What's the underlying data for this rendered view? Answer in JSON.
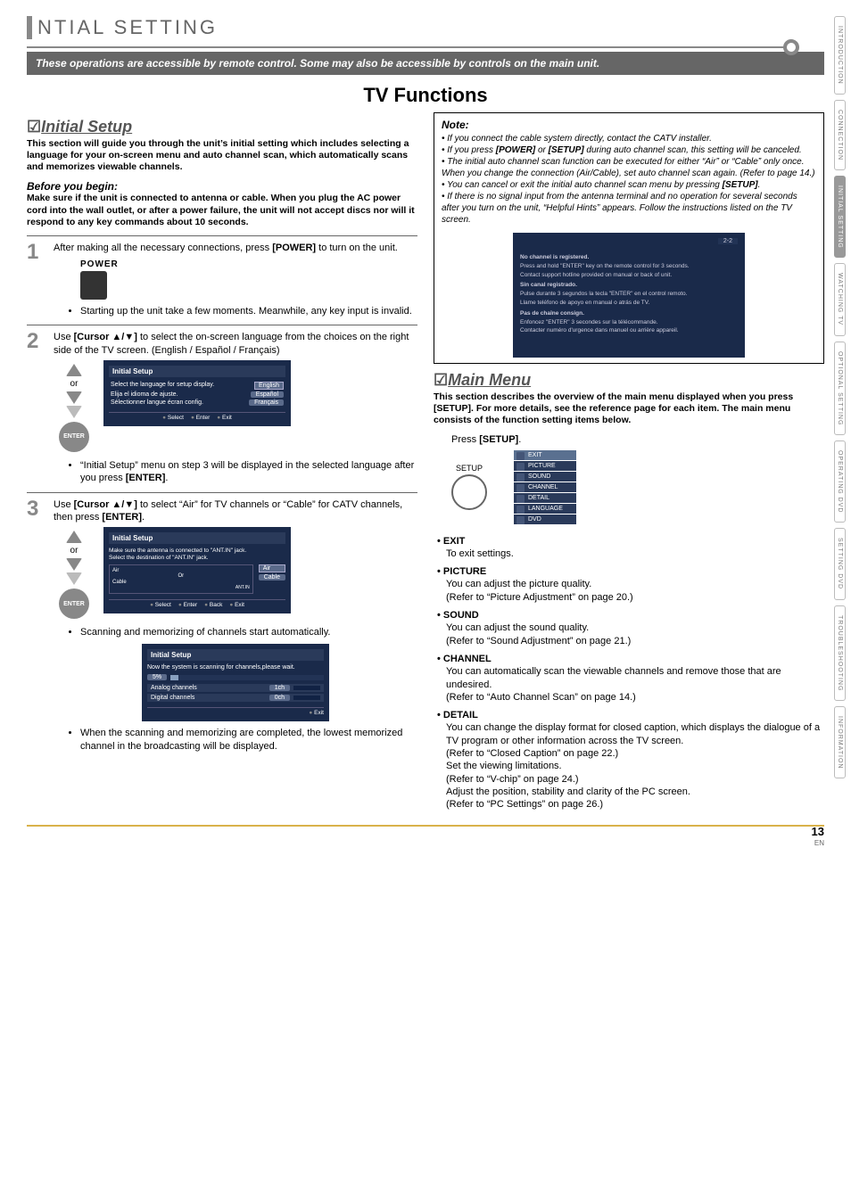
{
  "tabs": [
    "INTRODUCTION",
    "CONNECTION",
    "INITIAL SETTING",
    "WATCHING TV",
    "OPTIONAL SETTING",
    "OPERATING DVD",
    "SETTING DVD",
    "TROUBLESHOOTING",
    "INFORMATION"
  ],
  "active_tab_index": 2,
  "header_title": "NTIAL SETTING",
  "note_bar": "These operations are accessible by remote control. Some may also be accessible by controls on the main unit.",
  "section_title": "TV Functions",
  "left": {
    "heading": "Initial Setup",
    "intro": "This section will guide you through the unit’s initial setting which includes selecting a language for your on-screen menu and auto channel scan, which automatically scans and memorizes viewable channels.",
    "before_label": "Before you begin:",
    "before_text": "Make sure if the unit is connected to antenna or cable. When you plug the AC power cord into the wall outlet, or after a power failure, the unit will not accept discs nor will it respond to any key commands about 10 seconds.",
    "steps": {
      "s1": {
        "num": "1",
        "text_a": "After making all the necessary connections, press ",
        "text_b": "[POWER]",
        "text_c": " to turn on the unit.",
        "power_label": "POWER",
        "sub1": "Starting up the unit take a few moments. Meanwhile, any key input is invalid."
      },
      "s2": {
        "num": "2",
        "text_a": "Use ",
        "text_b": "[Cursor ▲/▼]",
        "text_c": " to select the on-screen language from the choices on the right side of the TV screen. (English / Español / Français)",
        "or": "or",
        "enter": "ENTER",
        "osd_title": "Initial Setup",
        "osd_r1_l": "Select the language for setup display.",
        "osd_r1_r": "English",
        "osd_r2_l": "Elija el idioma de ajuste.",
        "osd_r2_r": "Español",
        "osd_r3_l": "Sélectionner langue écran config.",
        "osd_r3_r": "Français",
        "osd_btns": [
          "Select",
          "Enter",
          "Exit"
        ],
        "sub1_a": "“Initial Setup” menu on step 3 will be displayed in the selected language after you press ",
        "sub1_b": "[ENTER]",
        "sub1_c": "."
      },
      "s3": {
        "num": "3",
        "text_a": "Use ",
        "text_b": "[Cursor ▲/▼]",
        "text_c": " to select “Air” for TV channels or “Cable” for CATV channels, then press ",
        "text_d": "[ENTER]",
        "text_e": ".",
        "or": "or",
        "enter": "ENTER",
        "osd_title": "Initial Setup",
        "osd_line1": "Make sure the antenna is connected to \"ANT.IN\" jack.",
        "osd_line2": "Select the destination of \"ANT.IN\" jack.",
        "osd_air": "Air",
        "osd_cable": "Cable",
        "osd_diag_air": "Air",
        "osd_diag_or": "Or",
        "osd_diag_cable": "Cable",
        "osd_diag_ant": "ANT.IN",
        "osd_btns": [
          "Select",
          "Enter",
          "Back",
          "Exit"
        ],
        "sub1": "Scanning and memorizing of channels start automatically.",
        "scan_title": "Initial Setup",
        "scan_msg": "Now the system is scanning for channels,please wait.",
        "scan_pct": "5%",
        "scan_analog_l": "Analog channels",
        "scan_analog_v": "1ch",
        "scan_digital_l": "Digital channels",
        "scan_digital_v": "0ch",
        "scan_exit": "Exit",
        "sub2": "When the scanning and memorizing are completed, the lowest memorized channel in the broadcasting will be displayed."
      }
    }
  },
  "right": {
    "note_title": "Note:",
    "notes": [
      "If you connect the cable system directly, contact the CATV installer.",
      "If you press <b>[POWER]</b> or <b>[SETUP]</b> during auto channel scan, this setting will be canceled.",
      "The initial auto channel scan function can be executed for either “Air” or “Cable” only once. When you change the connection (Air/Cable), set auto channel scan again. (Refer to page 14.)",
      "You can cancel or exit the initial auto channel scan menu by pressing <b>[SETUP]</b>.",
      "If there is no signal input from the antenna terminal and no operation for several seconds after you turn on the unit, “Helpful Hints” appears. Follow the instructions listed on the TV screen."
    ],
    "hh_corner": "2-2",
    "hh": {
      "en_h": "No channel is registered.",
      "en_1": "Press and hold \"ENTER\" key on the remote control for 3 seconds.",
      "en_2": "Contact support hotline provided on manual or back of unit.",
      "es_h": "Sin canal registrado.",
      "es_1": "Pulse durante 3 segundos la tecla \"ENTER\" en el control remoto.",
      "es_2": "Llame teléfono de apoyo en manual o atrás de TV.",
      "fr_h": "Pas de chaîne consign.",
      "fr_1": "Enfoncez \"ENTER\" 3 secondes sur la télécommande.",
      "fr_2": "Contacter numéro d'urgence dans manuel ou arrière appareil."
    },
    "main_heading": "Main Menu",
    "main_intro": "This section describes the overview of the main menu displayed when you press [SETUP]. For more details, see the reference page for each item. The main menu consists of the function setting items below.",
    "press_setup_a": "Press ",
    "press_setup_b": "[SETUP]",
    "press_setup_c": ".",
    "setup_label": "SETUP",
    "menu_items": [
      "EXIT",
      "PICTURE",
      "SOUND",
      "CHANNEL",
      "DETAIL",
      "LANGUAGE",
      "DVD"
    ],
    "menu_selected_index": 0,
    "bullets": [
      {
        "title": "EXIT",
        "lines": [
          "To exit settings."
        ]
      },
      {
        "title": "PICTURE",
        "lines": [
          "You can adjust the picture quality.",
          "(Refer to “Picture Adjustment” on page 20.)"
        ]
      },
      {
        "title": "SOUND",
        "lines": [
          "You can adjust the sound quality.",
          "(Refer to “Sound Adjustment” on page 21.)"
        ]
      },
      {
        "title": "CHANNEL",
        "lines": [
          "You can automatically scan the viewable channels and remove those that are undesired.",
          "(Refer to “Auto Channel Scan” on page 14.)"
        ]
      },
      {
        "title": "DETAIL",
        "lines": [
          "You can change the display format for closed caption, which displays the dialogue of a TV program or other information across the TV screen.",
          "(Refer to “Closed Caption” on page 22.)",
          "Set the viewing limitations.",
          "(Refer to “V-chip” on page 24.)",
          "Adjust the position, stability and clarity of the PC screen.",
          "(Refer to “PC Settings” on page 26.)"
        ]
      }
    ]
  },
  "chart_data": {
    "type": "bar",
    "title": "Auto channel scan progress",
    "categories": [
      "Analog channels",
      "Digital channels"
    ],
    "values": [
      1,
      0
    ],
    "progress_percent": 5,
    "xlabel": "",
    "ylabel": "channels"
  },
  "footer": {
    "page": "13",
    "lang": "EN"
  }
}
